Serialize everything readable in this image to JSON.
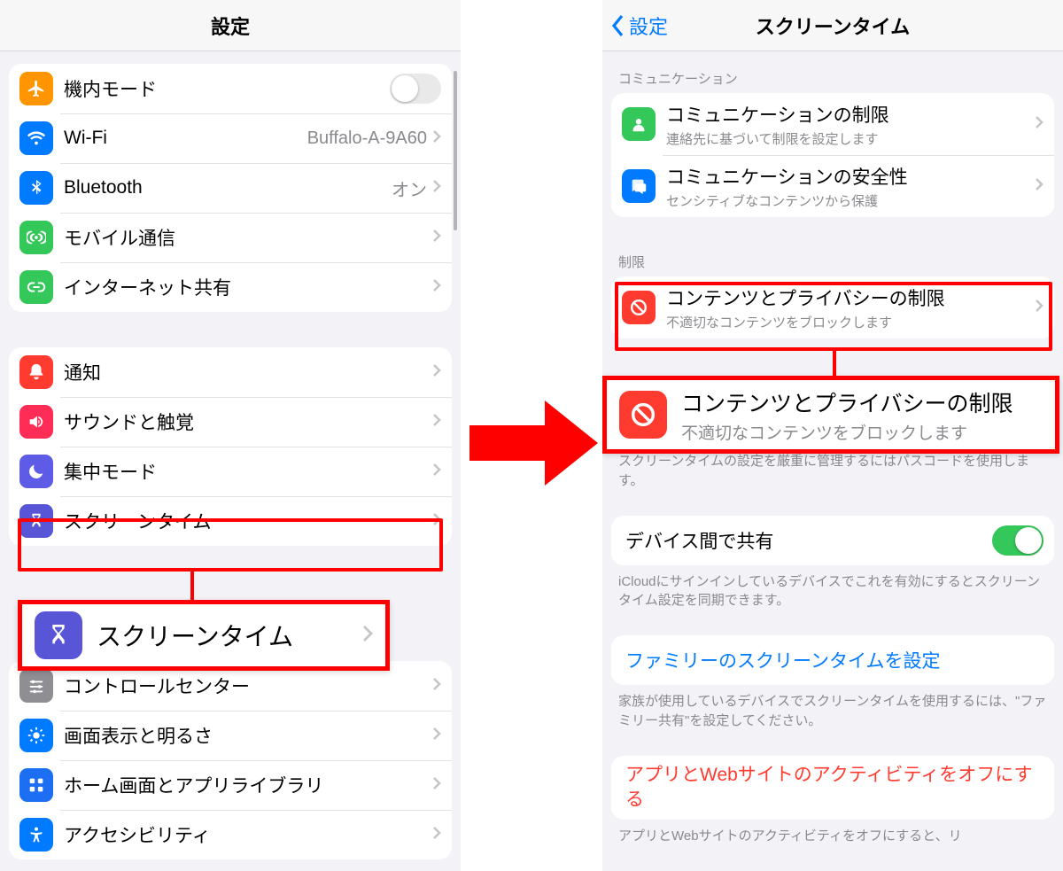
{
  "left": {
    "nav_title": "設定",
    "groups": [
      {
        "rows": [
          {
            "icon": "airplane",
            "icon_bg": "bg-orange",
            "title": "機内モード",
            "control": "toggle-off"
          },
          {
            "icon": "wifi",
            "icon_bg": "bg-blue",
            "title": "Wi-Fi",
            "value": "Buffalo-A-9A60",
            "control": "chevron"
          },
          {
            "icon": "bluetooth",
            "icon_bg": "bg-blue",
            "title": "Bluetooth",
            "value": "オン",
            "control": "chevron"
          },
          {
            "icon": "antenna",
            "icon_bg": "bg-green",
            "title": "モバイル通信",
            "control": "chevron"
          },
          {
            "icon": "link",
            "icon_bg": "bg-link",
            "title": "インターネット共有",
            "control": "chevron"
          }
        ]
      },
      {
        "rows": [
          {
            "icon": "bell",
            "icon_bg": "bg-red",
            "title": "通知",
            "control": "chevron"
          },
          {
            "icon": "speaker",
            "icon_bg": "bg-redpink",
            "title": "サウンドと触覚",
            "control": "chevron"
          },
          {
            "icon": "moon",
            "icon_bg": "bg-indigo",
            "title": "集中モード",
            "control": "chevron"
          },
          {
            "icon": "hourglass",
            "icon_bg": "bg-purple",
            "title": "スクリーンタイム",
            "control": "chevron",
            "highlight": true
          }
        ]
      },
      {
        "rows": [
          {
            "icon": "sliders",
            "icon_bg": "bg-gray",
            "title": "コントロールセンター",
            "control": "chevron"
          },
          {
            "icon": "sun",
            "icon_bg": "bg-blue",
            "title": "画面表示と明るさ",
            "control": "chevron"
          },
          {
            "icon": "grid",
            "icon_bg": "bg-navy",
            "title": "ホーム画面とアプリライブラリ",
            "control": "chevron"
          },
          {
            "icon": "accessibility",
            "icon_bg": "bg-blue",
            "title": "アクセシビリティ",
            "control": "chevron"
          }
        ]
      }
    ],
    "callout_title": "スクリーンタイム"
  },
  "right": {
    "nav_back": "設定",
    "nav_title": "スクリーンタイム",
    "section_comm_header": "コミュニケーション",
    "rows_comm": [
      {
        "icon": "contact",
        "icon_bg": "bg-green",
        "title": "コミュニケーションの制限",
        "sub": "連絡先に基づいて制限を設定します"
      },
      {
        "icon": "chat",
        "icon_bg": "bg-blue",
        "title": "コミュニケーションの安全性",
        "sub": "センシティブなコンテンツから保護"
      }
    ],
    "section_limit_header": "制限",
    "rows_limit": [
      {
        "icon": "no",
        "icon_bg": "bg-privacy",
        "title": "コンテンツとプライバシーの制限",
        "sub": "不適切なコンテンツをブロックします",
        "highlight": true
      }
    ],
    "callout_title": "コンテンツとプライバシーの制限",
    "callout_sub": "不適切なコンテンツをブロックします",
    "passcode_note": "スクリーンタイムの設定を厳重に管理するにはパスコードを使用します。",
    "share_row_title": "デバイス間で共有",
    "share_note": "iCloudにサインインしているデバイスでこれを有効にするとスクリーンタイム設定を同期できます。",
    "family_link": "ファミリーのスクリーンタイムを設定",
    "family_note": "家族が使用しているデバイスでスクリーンタイムを使用するには、\"ファミリー共有\"を設定してください。",
    "off_link": "アプリとWebサイトのアクティビティをオフにする",
    "off_note": "アプリとWebサイトのアクティビティをオフにすると、リ"
  }
}
